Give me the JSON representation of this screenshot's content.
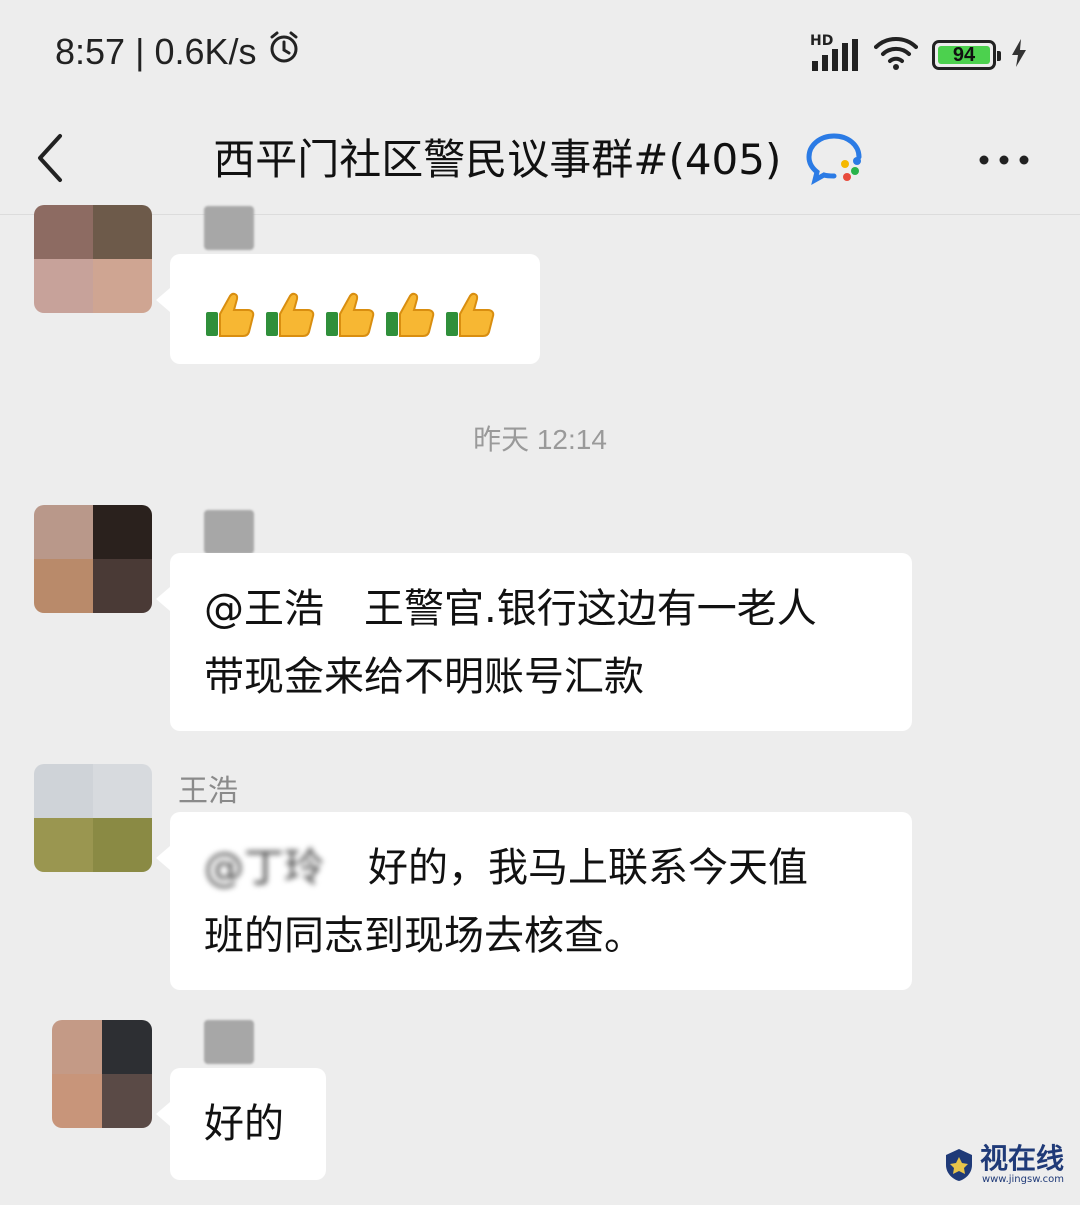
{
  "status_bar": {
    "time": "8:57",
    "separator": "|",
    "net_speed": "0.6K/s",
    "network_type": "HD",
    "battery_level": "94",
    "icons": [
      "alarm-icon",
      "signal-icon",
      "wifi-icon",
      "battery-icon",
      "charging-icon"
    ]
  },
  "header": {
    "title": "西平门社区警民议事群#(405)",
    "icons": [
      "back-icon",
      "enterprise-chat-icon",
      "more-icon"
    ]
  },
  "messages": [
    {
      "type": "emoji",
      "emoji_count": 5,
      "emoji": "thumbs-up"
    },
    {
      "type": "time",
      "text": "昨天 12:14"
    },
    {
      "type": "text",
      "lines": [
        "@王浩　王警官.银行这边有一老人",
        "带现金来给不明账号汇款"
      ]
    },
    {
      "type": "text",
      "sender": "王浩",
      "mention_blurred": "@丁玲",
      "lines": [
        "好的，我马上联系今天值",
        "班的同志到现场去核查。"
      ]
    },
    {
      "type": "text",
      "lines": [
        "好的"
      ]
    }
  ],
  "watermark": {
    "text": "视在线",
    "sub": "www.jingsw.com",
    "brand_color": "#1f3a78"
  },
  "colors": {
    "background": "#ededed",
    "bubble": "#ffffff",
    "battery": "#4cd14e"
  }
}
